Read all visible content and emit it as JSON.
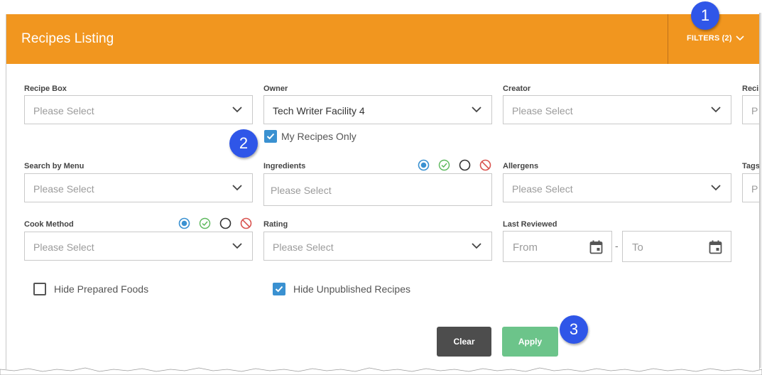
{
  "header": {
    "title": "Recipes Listing",
    "filters_label": "FILTERS (2)"
  },
  "filters": {
    "recipe_box": {
      "label": "Recipe Box",
      "placeholder": "Please Select"
    },
    "owner": {
      "label": "Owner",
      "value": "Tech Writer Facility 4",
      "my_recipes_only": "My Recipes Only"
    },
    "creator": {
      "label": "Creator",
      "placeholder": "Please Select"
    },
    "recipe_partial": {
      "label": "Reci",
      "placeholder": "P"
    },
    "search_by_menu": {
      "label": "Search by Menu",
      "placeholder": "Please Select"
    },
    "ingredients": {
      "label": "Ingredients",
      "placeholder": "Please Select"
    },
    "allergens": {
      "label": "Allergens",
      "placeholder": "Please Select"
    },
    "tags_partial": {
      "label": "Tags",
      "placeholder": "P"
    },
    "cook_method": {
      "label": "Cook Method",
      "placeholder": "Please Select"
    },
    "rating": {
      "label": "Rating",
      "placeholder": "Please Select"
    },
    "last_reviewed": {
      "label": "Last Reviewed",
      "from_placeholder": "From",
      "to_placeholder": "To",
      "separator": "-"
    },
    "hide_prepared_foods": "Hide Prepared Foods",
    "hide_unpublished": "Hide Unpublished Recipes"
  },
  "buttons": {
    "clear": "Clear",
    "apply": "Apply"
  },
  "callouts": [
    "1",
    "2",
    "3"
  ],
  "colors": {
    "header": "#f1961f",
    "accent_blue": "#3a91d1",
    "apply_green": "#6cc48a",
    "clear_gray": "#4d4d4d",
    "callout_blue": "#2f56e8",
    "include_green": "#5cb85c",
    "exclude_red": "#d9534f"
  },
  "icons": [
    "chevron-down-icon",
    "checkmark-icon",
    "calendar-icon",
    "radio-selected-icon",
    "include-check-icon",
    "empty-circle-icon",
    "exclude-icon"
  ]
}
